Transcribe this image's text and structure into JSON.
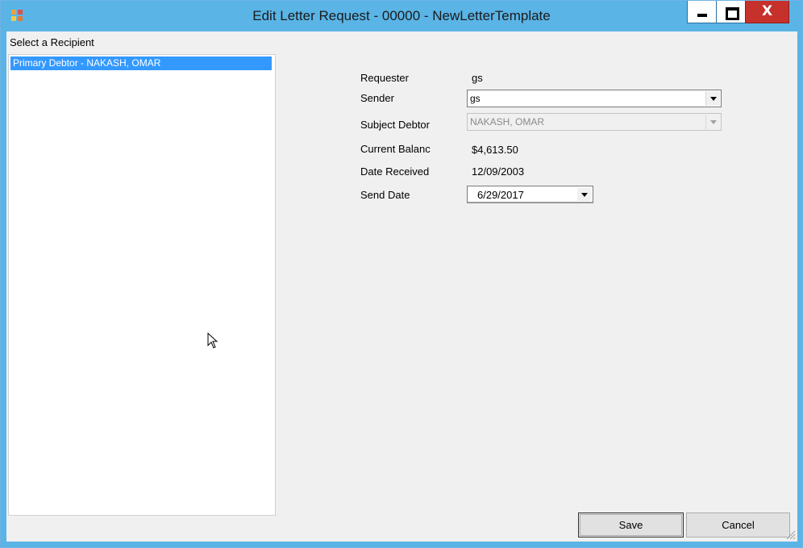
{
  "window": {
    "title": "Edit Letter Request - 00000 - NewLetterTemplate",
    "controls": {
      "minimize": "minimize",
      "maximize": "maximize",
      "close": "X"
    }
  },
  "recipients": {
    "label": "Select a Recipient",
    "items": [
      {
        "label": "Primary Debtor - NAKASH, OMAR",
        "selected": true
      }
    ]
  },
  "form": {
    "requester": {
      "label": "Requester",
      "value": "gs"
    },
    "sender": {
      "label": "Sender",
      "value": "gs"
    },
    "subject_debtor": {
      "label": "Subject Debtor",
      "value": "NAKASH, OMAR",
      "disabled": true
    },
    "current_balance": {
      "label": "Current Balanc",
      "value": "$4,613.50"
    },
    "date_received": {
      "label": "Date Received",
      "value": "12/09/2003"
    },
    "send_date": {
      "label": "Send Date",
      "value": "6/29/2017"
    }
  },
  "buttons": {
    "save": "Save",
    "cancel": "Cancel"
  },
  "colors": {
    "titlebar": "#5ab4e6",
    "selection": "#3399ff",
    "close_button": "#c7312b",
    "client_background": "#f0f0f0"
  },
  "icons": [
    "app-icon",
    "minimize-icon",
    "maximize-icon",
    "close-icon",
    "dropdown-arrow-icon",
    "mouse-cursor-icon",
    "resize-grip-icon"
  ]
}
